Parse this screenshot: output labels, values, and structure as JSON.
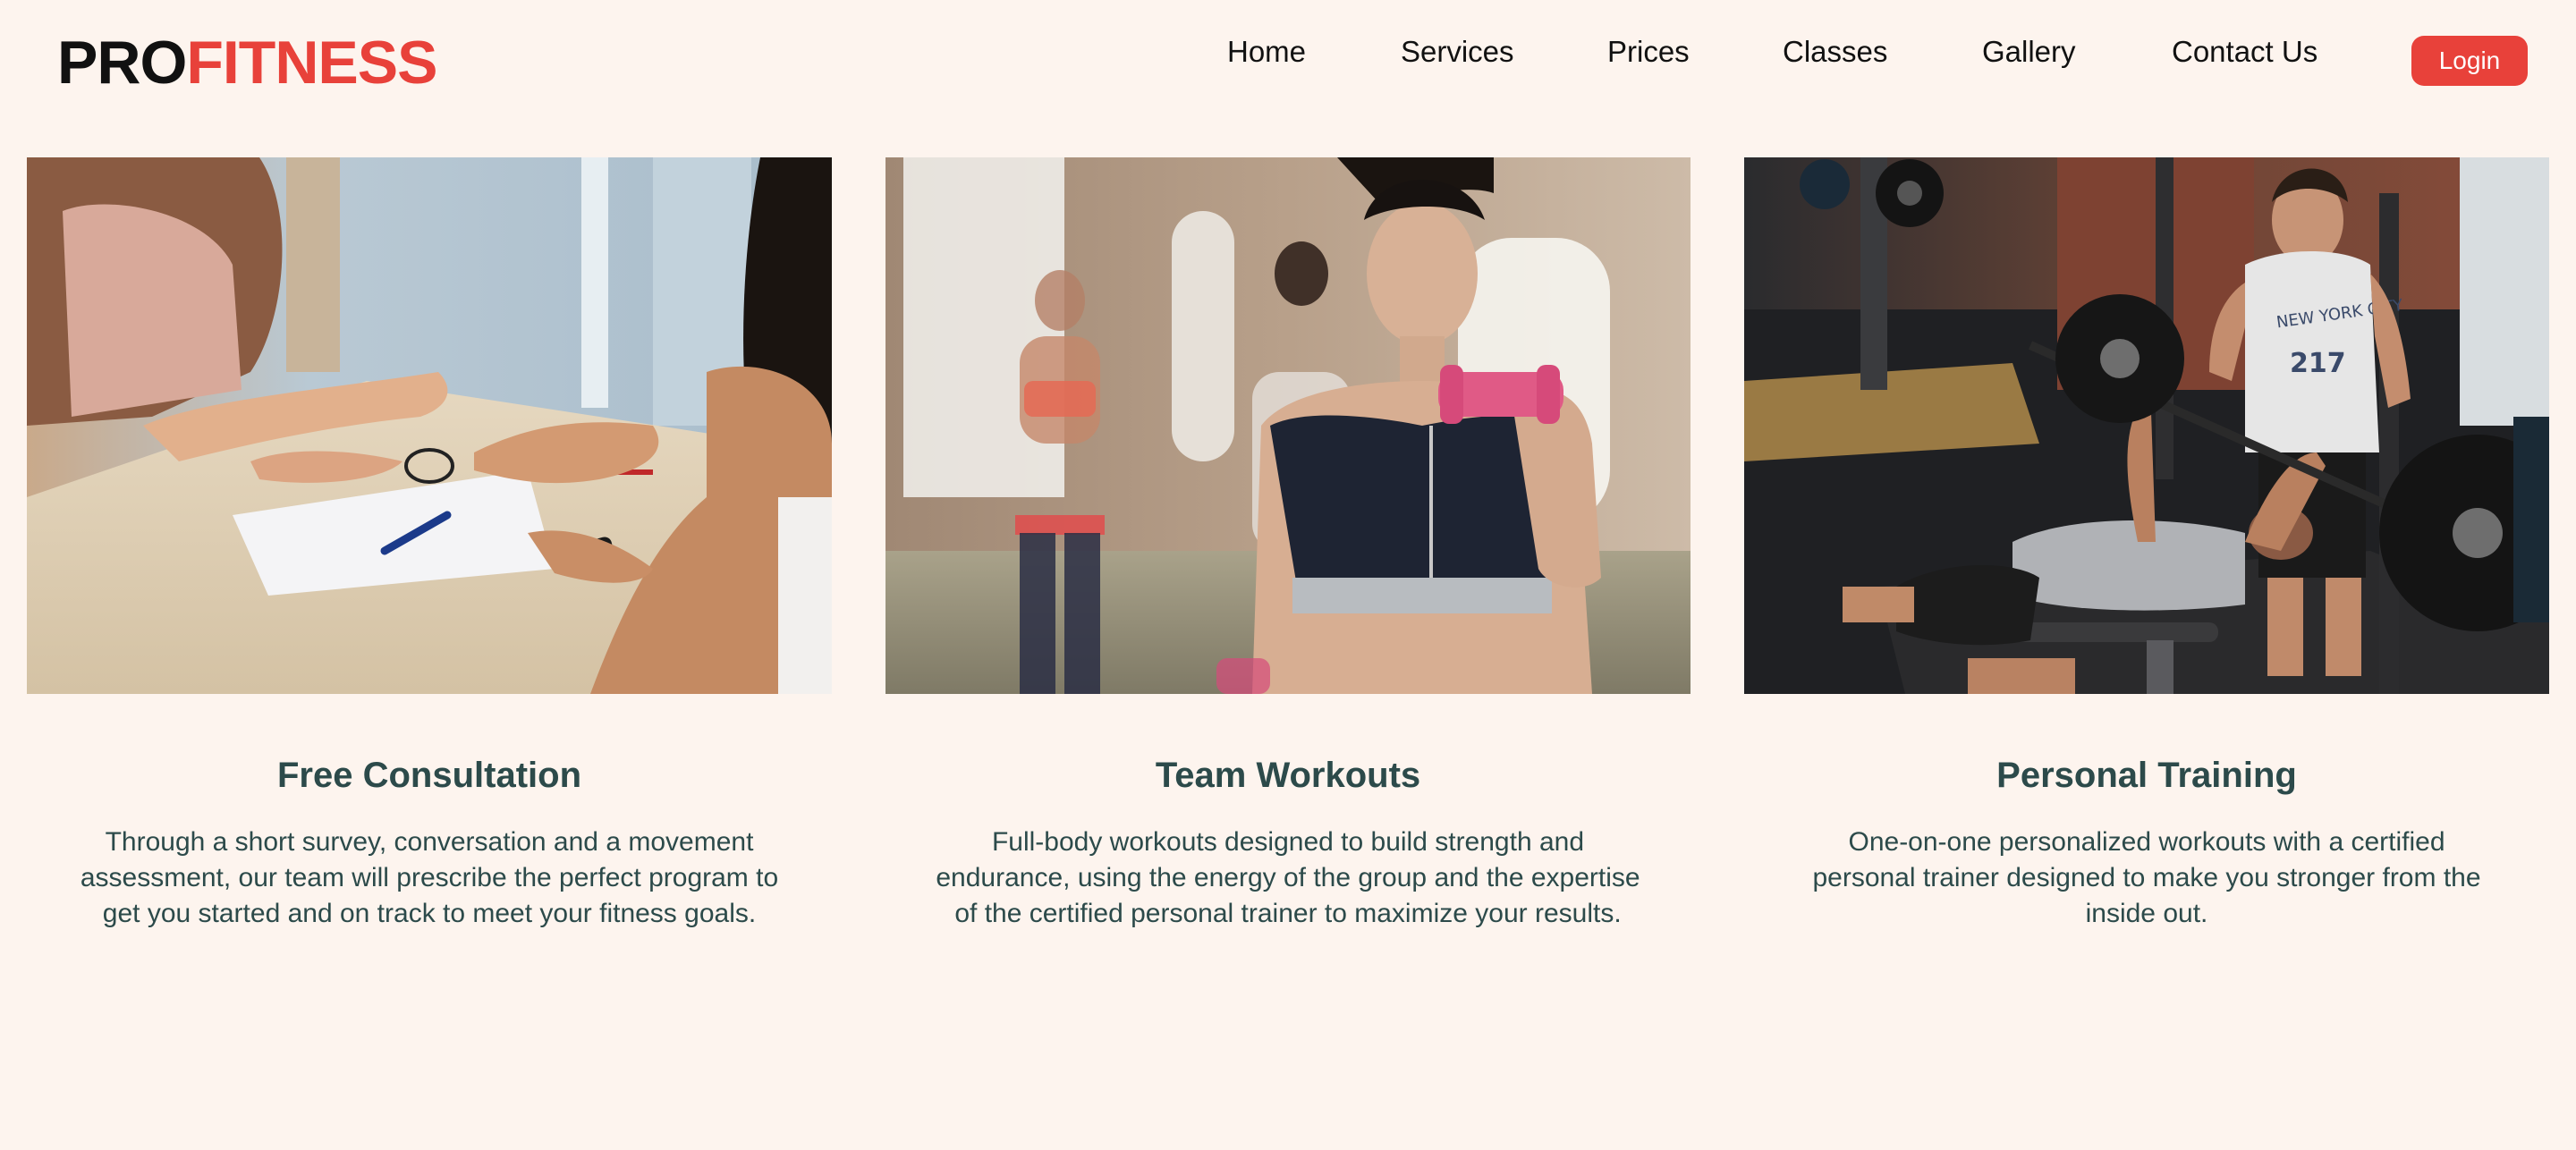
{
  "brand": {
    "logo_part1": "PRO",
    "logo_part2": "FITNESS",
    "accent_color": "#e8413a"
  },
  "nav": {
    "items": [
      "Home",
      "Services",
      "Prices",
      "Classes",
      "Gallery",
      "Contact Us"
    ],
    "login_label": "Login"
  },
  "cards": [
    {
      "title": "Free Consultation",
      "description": "Through a short survey, conversation and a movement assessment, our team will prescribe the perfect program to get you started and on track to meet your fitness goals.",
      "image": "consultation-photo"
    },
    {
      "title": "Team Workouts",
      "description": "Full-body workouts designed to build strength and endurance, using the energy of the group and the expertise of the certified personal trainer to maximize your results.",
      "image": "team-workout-photo"
    },
    {
      "title": "Personal Training",
      "description": "One-on-one personalized workouts with a certified personal trainer designed to make you stronger from the inside out.",
      "image": "personal-training-photo"
    }
  ],
  "colors": {
    "background": "#fdf4ee",
    "heading_text": "#2c4a4a",
    "nav_text": "#111111"
  }
}
